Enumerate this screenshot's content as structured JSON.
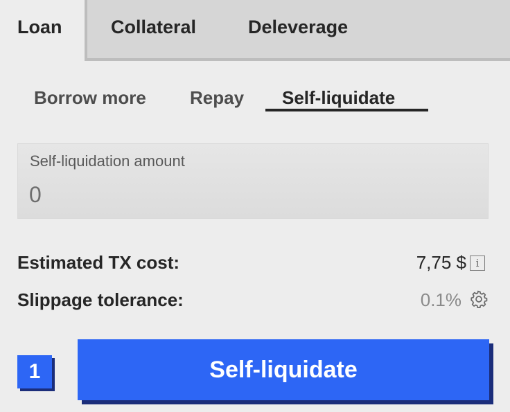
{
  "tabs": [
    {
      "label": "Loan",
      "active": true
    },
    {
      "label": "Collateral",
      "active": false
    },
    {
      "label": "Deleverage",
      "active": false
    }
  ],
  "subtabs": [
    {
      "label": "Borrow more",
      "active": false
    },
    {
      "label": "Repay",
      "active": false
    },
    {
      "label": "Self-liquidate",
      "active": true
    }
  ],
  "amount": {
    "label": "Self-liquidation amount",
    "placeholder": "0"
  },
  "tx_cost": {
    "label": "Estimated TX cost:",
    "value": "7,75 $",
    "icon": "info-icon"
  },
  "slippage": {
    "label": "Slippage tolerance:",
    "value": "0.1%",
    "icon": "gear-icon"
  },
  "action": {
    "step": "1",
    "button_label": "Self-liquidate"
  },
  "colors": {
    "primary": "#2d66f5",
    "shadow": "#1b2d7a",
    "background": "#ededed",
    "inactive_tab": "#d6d6d6"
  }
}
